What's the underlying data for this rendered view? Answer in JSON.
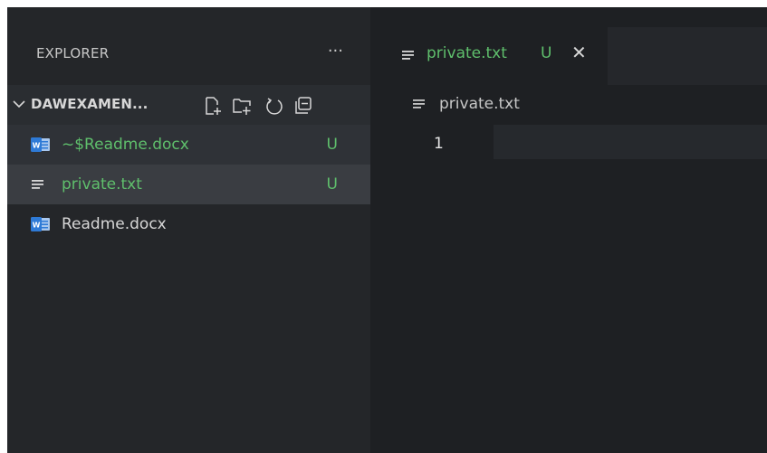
{
  "explorer": {
    "title": "EXPLORER",
    "more_icon": "more-icon",
    "folder": {
      "name": "DAWEXAMEN...",
      "actions": [
        "new-file-icon",
        "new-folder-icon",
        "refresh-icon",
        "collapse-all-icon"
      ]
    },
    "files": [
      {
        "name": "~$Readme.docx",
        "badge": "U",
        "icon": "word-icon"
      },
      {
        "name": "private.txt",
        "badge": "U",
        "icon": "text-file-icon"
      },
      {
        "name": "Readme.docx",
        "badge": "",
        "icon": "word-icon"
      }
    ]
  },
  "editor": {
    "tab": {
      "label": "private.txt",
      "badge": "U",
      "close": "✕",
      "icon": "text-file-icon"
    },
    "breadcrumb": {
      "label": "private.txt",
      "icon": "text-file-icon"
    },
    "lines": [
      "1"
    ]
  },
  "colors": {
    "untracked": "#5fbf6c",
    "word": "#2e7ad6",
    "background": "#1f2125"
  }
}
